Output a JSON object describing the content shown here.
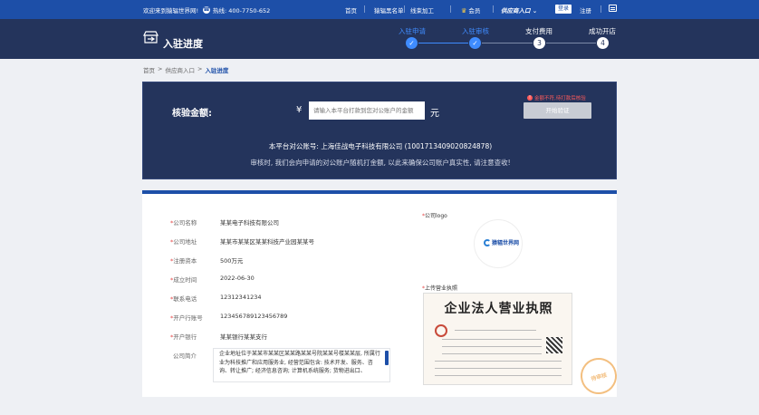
{
  "topbar": {
    "welcome": "欢迎来到猿辐世界网!",
    "hotline": "热线: 400-7750-652",
    "nav": {
      "home": "首页",
      "ranking": "猿辐黑名单",
      "process": "线束加工",
      "member": "会员",
      "supplier_entry": "供应商入口",
      "login": "登录",
      "register": "注册"
    }
  },
  "header": {
    "title": "入驻进度",
    "steps": [
      {
        "label": "入驻申请",
        "status": "done"
      },
      {
        "label": "入驻审核",
        "status": "done"
      },
      {
        "label": "支付费用",
        "status": "todo",
        "num": "3"
      },
      {
        "label": "成功开店",
        "status": "todo",
        "num": "4"
      }
    ]
  },
  "breadcrumb": {
    "home": "首页",
    "sep": ">",
    "entry": "供应商入口",
    "current": "入驻进度"
  },
  "verify": {
    "amount_label": "核验金额:",
    "currency": "¥",
    "placeholder": "请输入本平台打款到您对公账户的金额",
    "unit": "元",
    "error": "金额不符,待打款后核验",
    "start_button": "开始验证",
    "account": "本平台对公账号: 上海佳战电子科技有限公司 (1001713409020824878)",
    "notice": "审核时, 我们会向申请的对公账户随机打金额, 以此来确保公司账户真实性, 请注意查收!"
  },
  "info": {
    "rows": [
      {
        "label": "公司名称",
        "value": "某某电子科技有限公司",
        "required": true
      },
      {
        "label": "公司地址",
        "value": "某某市某某区某某科技产业园某某号",
        "required": true
      },
      {
        "label": "注册资本",
        "value": "500万元",
        "required": true
      },
      {
        "label": "成立时间",
        "value": "2022-06-30",
        "required": true
      },
      {
        "label": "联系电话",
        "value": "12312341234",
        "required": true
      },
      {
        "label": "开户行账号",
        "value": "123456789123456789",
        "required": true
      },
      {
        "label": "开户银行",
        "value": "某某银行某某支行",
        "required": true
      }
    ],
    "intro_label": "公司简介",
    "intro_text": "企业地址位于某某市某某区某某路某某号院某某号楼某某层, 所属行业为科技推广和应用服务业, 经营范围包含: 技术开发、服务、咨询、转让推广; 经济信息咨询; 计算机系统服务; 货物进出口、",
    "logo_label": "公司logo",
    "logo_text": "猿辐世界网",
    "license_label": "上传营业执照",
    "license_title": "企业法人营业执照",
    "stamp_text": "待审核"
  },
  "colors": {
    "topbar": "#1d4fa8",
    "header": "#24345c",
    "accent": "#3f8cff",
    "error": "#ff5a5a"
  }
}
